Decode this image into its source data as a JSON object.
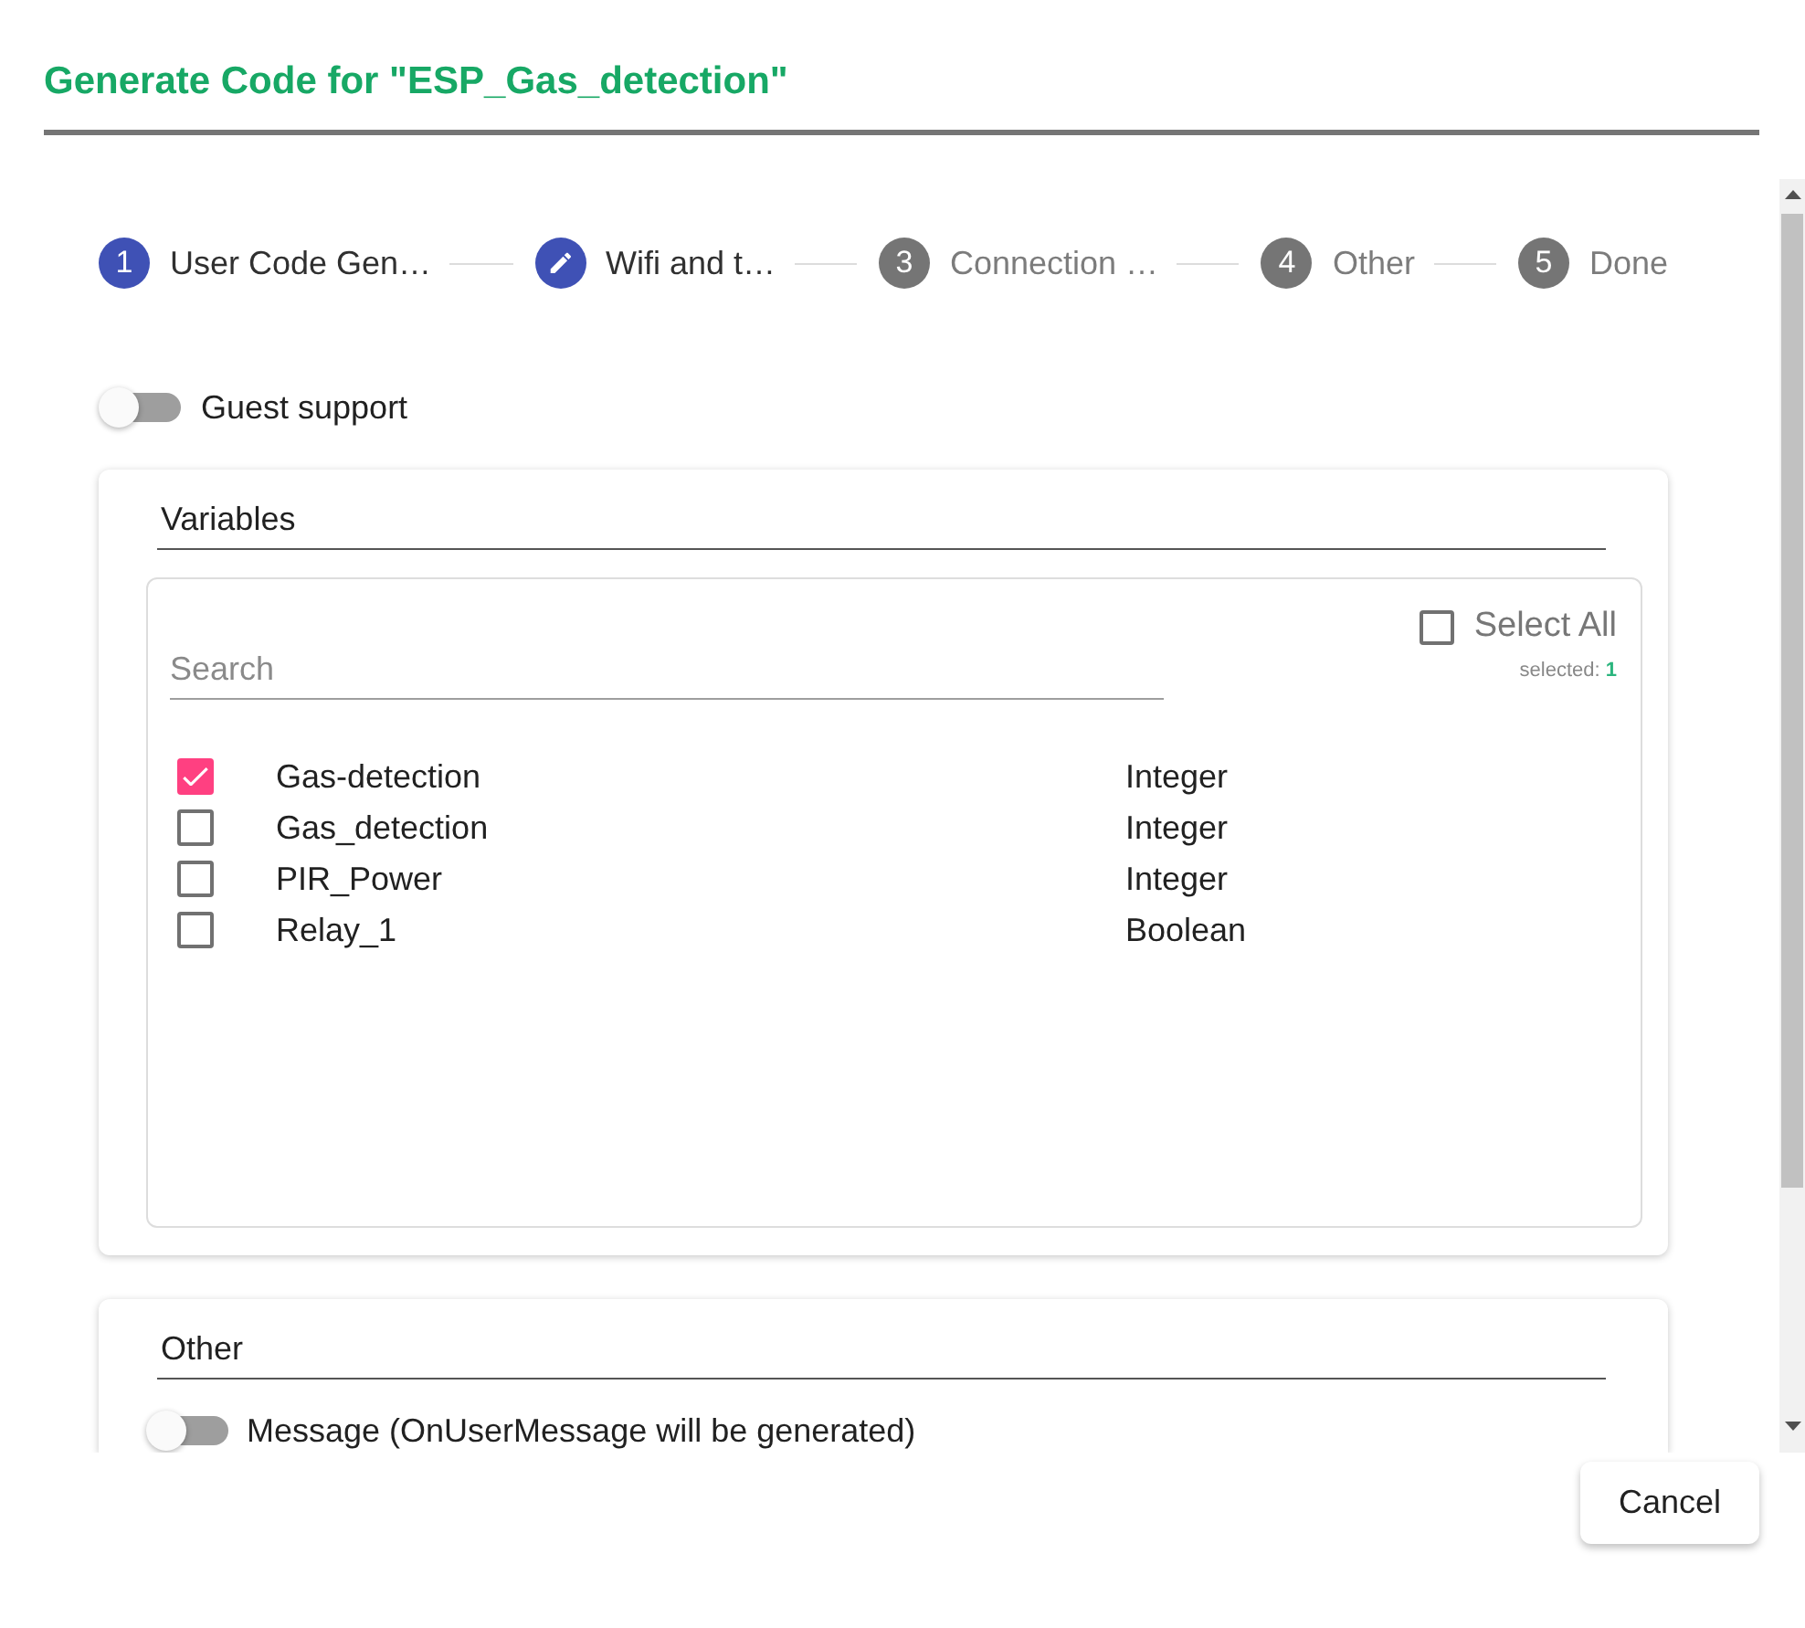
{
  "dialog": {
    "title": "Generate Code for \"ESP_Gas_detection\""
  },
  "stepper": [
    {
      "kind": "number",
      "number": "1",
      "label": "User Code Gen…",
      "active": true
    },
    {
      "kind": "edit",
      "label": "Wifi and t…",
      "active": true
    },
    {
      "kind": "number",
      "number": "3",
      "label": "Connection …",
      "active": false
    },
    {
      "kind": "number",
      "number": "4",
      "label": "Other",
      "active": false
    },
    {
      "kind": "number",
      "number": "5",
      "label": "Done",
      "active": false
    }
  ],
  "guest_support": {
    "label": "Guest support",
    "on": false
  },
  "variables": {
    "title": "Variables",
    "search": {
      "placeholder": "Search"
    },
    "select_all": {
      "label": "Select All",
      "checked": false
    },
    "selected_count": {
      "label": "selected:",
      "value": "1"
    },
    "rows": [
      {
        "name": "Gas-detection",
        "type": "Integer",
        "checked": true
      },
      {
        "name": "Gas_detection",
        "type": "Integer",
        "checked": false
      },
      {
        "name": "PIR_Power",
        "type": "Integer",
        "checked": false
      },
      {
        "name": "Relay_1",
        "type": "Boolean",
        "checked": false
      }
    ]
  },
  "other": {
    "title": "Other",
    "message": {
      "label": "Message (OnUserMessage will be generated)",
      "on": false
    }
  },
  "buttons": [
    {
      "label": "Cancel"
    }
  ]
}
